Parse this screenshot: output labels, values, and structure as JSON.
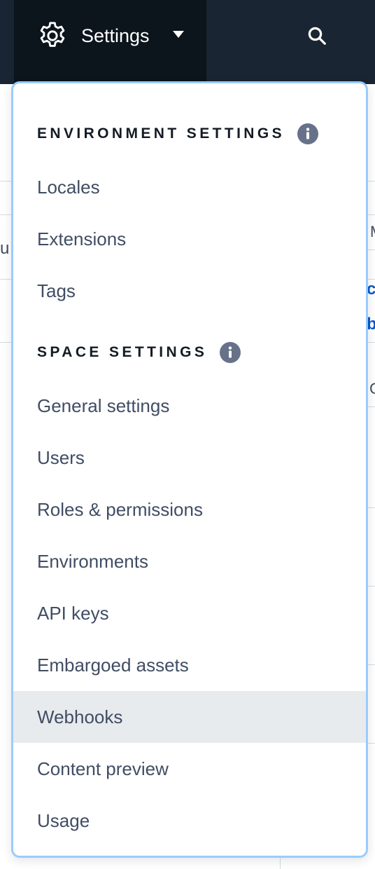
{
  "navbar": {
    "settings_label": "Settings",
    "settings_icon": "gear-icon",
    "caret_icon": "caret-down-icon",
    "search_icon": "search-icon"
  },
  "background": {
    "fragments": [
      "u",
      "M",
      "c",
      "b",
      "C"
    ]
  },
  "menu": {
    "environment_settings": {
      "header": "ENVIRONMENT SETTINGS",
      "items": [
        "Locales",
        "Extensions",
        "Tags"
      ]
    },
    "space_settings": {
      "header": "SPACE SETTINGS",
      "items": [
        "General settings",
        "Users",
        "Roles & permissions",
        "Environments",
        "API keys",
        "Embargoed assets",
        "Webhooks",
        "Content preview",
        "Usage"
      ]
    },
    "active_item": "Webhooks"
  },
  "colors": {
    "navbar_bg": "#192532",
    "settings_tab_bg": "#0c141c",
    "menu_border": "#99ccff",
    "active_item_bg": "#e7ebee",
    "item_text": "#414d63",
    "header_text": "#141b24",
    "info_icon_bg": "#67728a",
    "link_blue": "#0059c8"
  }
}
